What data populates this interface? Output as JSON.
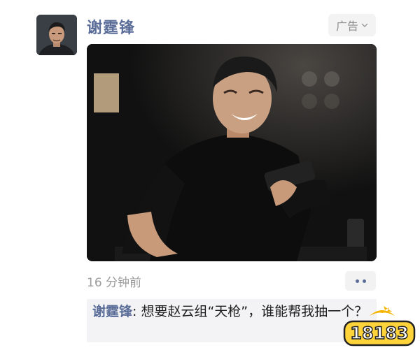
{
  "post": {
    "author": "谢霆锋",
    "ad_label": "广告",
    "timestamp": "16 分钟前",
    "photo_description": "man-in-black-shirt-looking-at-phone"
  },
  "comment": {
    "author": "谢霆锋",
    "separator": ": ",
    "text": "想要赵云组“天枪”，谁能帮我抽一个？"
  },
  "watermark": {
    "text": "18183"
  },
  "colors": {
    "name_link": "#5a6c98",
    "ad_bg": "#f3f3f4",
    "comment_bg": "#f3f3f5",
    "watermark_yellow": "#f5b400"
  },
  "icons": {
    "ad_dropdown": "chevron-down-icon",
    "more": "more-dots-icon"
  }
}
